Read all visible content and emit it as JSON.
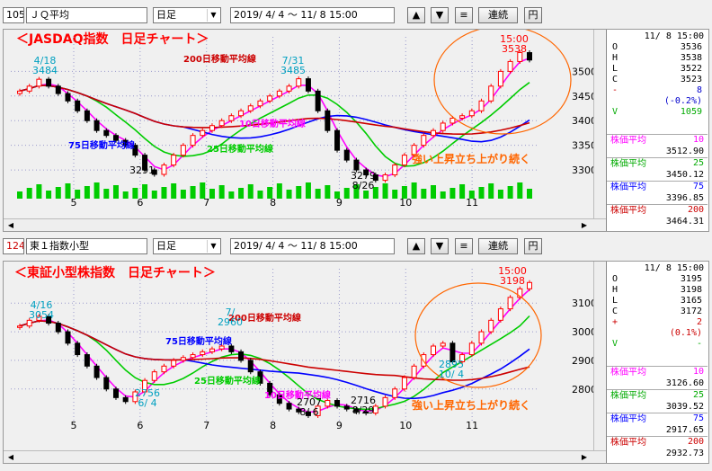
{
  "toolbars": [
    {
      "code": "105",
      "name": "ＪＱ平均",
      "period": "日足",
      "range": "2019/ 4/ 4 ～ 11/ 8 15:00",
      "buttons": [
        "▲",
        "▼",
        "≡",
        "連続",
        "円"
      ]
    },
    {
      "code": "124",
      "name": "東１指数小型",
      "period": "日足",
      "range": "2019/ 4/ 4 ～ 11/ 8 15:00",
      "buttons": [
        "▲",
        "▼",
        "≡",
        "連続",
        "円"
      ]
    }
  ],
  "colors": {
    "up": "#ff0000",
    "down": "#000000",
    "ma10": "#ff00ff",
    "ma25": "#00cc00",
    "ma75": "#0000ff",
    "ma200": "#cc0000",
    "volume": "#00cc00",
    "annot_blue": "#00a0c0",
    "annot_orange": "#ff6600"
  },
  "chart_data": [
    {
      "type": "candlestick",
      "title": "＜JASDAQ指数　日足チャート＞",
      "x_months": [
        "5",
        "6",
        "7",
        "8",
        "9",
        "10",
        "11"
      ],
      "y_ticks": [
        3300,
        3350,
        3400,
        3450,
        3500
      ],
      "ylim": [
        3260,
        3570
      ],
      "close_series": [
        3460,
        3470,
        3484,
        3470,
        3455,
        3440,
        3420,
        3400,
        3380,
        3370,
        3360,
        3350,
        3330,
        3300,
        3291,
        3310,
        3330,
        3350,
        3370,
        3380,
        3390,
        3400,
        3410,
        3420,
        3430,
        3440,
        3450,
        3460,
        3470,
        3485,
        3460,
        3420,
        3380,
        3340,
        3320,
        3300,
        3290,
        3279,
        3290,
        3310,
        3330,
        3350,
        3370,
        3380,
        3395,
        3405,
        3410,
        3420,
        3440,
        3470,
        3500,
        3520,
        3538,
        3523
      ],
      "ma_lines": [
        {
          "name": "10日移動平均線",
          "color": "#ff00ff"
        },
        {
          "name": "25日移動平均線",
          "color": "#00cc00"
        },
        {
          "name": "75日移動平均線",
          "color": "#0000ff"
        },
        {
          "name": "200日移動平均線",
          "color": "#cc0000"
        }
      ],
      "annotations": [
        {
          "text": "4/18",
          "sub": "3484"
        },
        {
          "text": "7/31",
          "sub": "3485"
        },
        {
          "text": "15:00",
          "sub": "3538"
        },
        {
          "text": "3291",
          "sub": ""
        },
        {
          "text": "3279",
          "sub": "8/26"
        },
        {
          "text": "強い上昇立ち上がり続く",
          "sub": ""
        }
      ],
      "has_volume": true
    },
    {
      "type": "candlestick",
      "title": "＜東証小型株指数　日足チャート＞",
      "x_months": [
        "5",
        "6",
        "7",
        "8",
        "9",
        "10",
        "11"
      ],
      "y_ticks": [
        2800,
        2900,
        3000,
        3100
      ],
      "ylim": [
        2680,
        3220
      ],
      "close_series": [
        3020,
        3040,
        3054,
        3030,
        3000,
        2960,
        2920,
        2880,
        2840,
        2800,
        2770,
        2756,
        2790,
        2830,
        2860,
        2880,
        2900,
        2910,
        2920,
        2930,
        2940,
        2950,
        2930,
        2900,
        2860,
        2820,
        2780,
        2750,
        2730,
        2720,
        2707,
        2740,
        2760,
        2740,
        2730,
        2720,
        2716,
        2740,
        2770,
        2800,
        2840,
        2880,
        2920,
        2950,
        2960,
        2895,
        2920,
        2960,
        3000,
        3040,
        3080,
        3120,
        3150,
        3172
      ],
      "ma_lines": [
        {
          "name": "10日移動平均線",
          "color": "#ff00ff"
        },
        {
          "name": "25日移動平均線",
          "color": "#00cc00"
        },
        {
          "name": "75日移動平均線",
          "color": "#0000ff"
        },
        {
          "name": "200日移動平均線",
          "color": "#cc0000"
        }
      ],
      "annotations": [
        {
          "text": "4/16",
          "sub": "3054"
        },
        {
          "text": "7/",
          "sub": "2960"
        },
        {
          "text": "2756",
          "sub": "6/ 4"
        },
        {
          "text": "2707",
          "sub": "8/ 6"
        },
        {
          "text": "2716",
          "sub": "8/29"
        },
        {
          "text": "2895",
          "sub": "10/ 4"
        },
        {
          "text": "15:00",
          "sub": "3198"
        },
        {
          "text": "強い上昇立ち上がり続く",
          "sub": ""
        }
      ],
      "has_volume": false
    }
  ],
  "sides": [
    {
      "datetime": "11/ 8 15:00",
      "ohlc": [
        {
          "k": "O",
          "v": "3536"
        },
        {
          "k": "H",
          "v": "3538"
        },
        {
          "k": "L",
          "v": "3522"
        },
        {
          "k": "C",
          "v": "3523"
        },
        {
          "k": "-",
          "v": "8"
        },
        {
          "k": "",
          "v": "(-0.2%)"
        },
        {
          "k": "V",
          "v": "1059"
        }
      ],
      "ma": [
        {
          "label": "株価平均",
          "n": "10",
          "v": "3512.90",
          "color": "#ff00ff"
        },
        {
          "label": "株価平均",
          "n": "25",
          "v": "3450.12",
          "color": "#00aa00"
        },
        {
          "label": "株価平均",
          "n": "75",
          "v": "3396.85",
          "color": "#0000ff"
        },
        {
          "label": "株価平均",
          "n": "200",
          "v": "3464.31",
          "color": "#cc0000"
        }
      ]
    },
    {
      "datetime": "11/ 8 15:00",
      "ohlc": [
        {
          "k": "O",
          "v": "3195"
        },
        {
          "k": "H",
          "v": "3198"
        },
        {
          "k": "L",
          "v": "3165"
        },
        {
          "k": "C",
          "v": "3172"
        },
        {
          "k": "+",
          "v": "2"
        },
        {
          "k": "",
          "v": "(0.1%)"
        },
        {
          "k": "V",
          "v": "-"
        }
      ],
      "ma": [
        {
          "label": "株価平均",
          "n": "10",
          "v": "3126.60",
          "color": "#ff00ff"
        },
        {
          "label": "株価平均",
          "n": "25",
          "v": "3039.52",
          "color": "#00aa00"
        },
        {
          "label": "株価平均",
          "n": "75",
          "v": "2917.65",
          "color": "#0000ff"
        },
        {
          "label": "株価平均",
          "n": "200",
          "v": "2932.73",
          "color": "#cc0000"
        }
      ]
    }
  ]
}
